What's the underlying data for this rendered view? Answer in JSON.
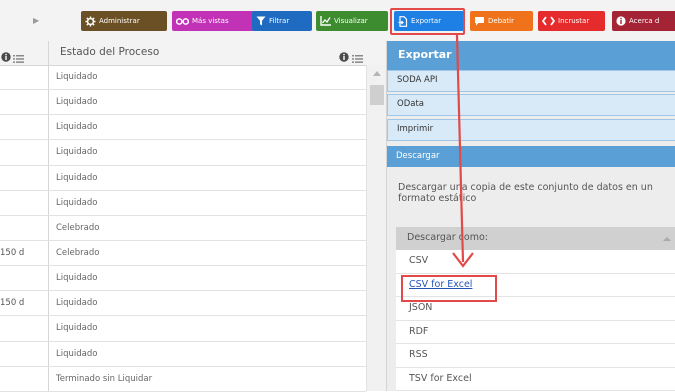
{
  "toolbar": {
    "buttons": [
      {
        "label": "Administrar",
        "icon": "gear-icon"
      },
      {
        "label": "Más vistas",
        "icon": "glasses-icon"
      },
      {
        "label": "Filtrar",
        "icon": "filter-icon"
      },
      {
        "label": "Visualizar",
        "icon": "chart-icon"
      },
      {
        "label": "Exportar",
        "icon": "export-icon"
      },
      {
        "label": "Debatir",
        "icon": "speech-bubble-icon"
      },
      {
        "label": "Incrustar",
        "icon": "code-brackets-icon"
      },
      {
        "label": "Acerca d",
        "icon": "info-icon"
      }
    ]
  },
  "grid": {
    "column_title": "Estado del Proceso",
    "rows": [
      {
        "left": "",
        "estado": "Liquidado"
      },
      {
        "left": "",
        "estado": "Liquidado"
      },
      {
        "left": "",
        "estado": "Liquidado"
      },
      {
        "left": "",
        "estado": "Liquidado"
      },
      {
        "left": "",
        "estado": "Liquidado"
      },
      {
        "left": "",
        "estado": "Liquidado"
      },
      {
        "left": "",
        "estado": "Celebrado"
      },
      {
        "left": "150 d",
        "estado": "Celebrado"
      },
      {
        "left": "",
        "estado": "Liquidado"
      },
      {
        "left": "150 d",
        "estado": "Liquidado"
      },
      {
        "left": "",
        "estado": "Liquidado"
      },
      {
        "left": "",
        "estado": "Liquidado"
      },
      {
        "left": "",
        "estado": "Terminado sin Liquidar"
      }
    ]
  },
  "panel": {
    "title": "Exportar",
    "options": [
      "SODA API",
      "OData",
      "Imprimir"
    ],
    "download_header": "Descargar",
    "download_desc": "Descargar una copia de este conjunto de datos en un formato estático",
    "format_header": "Descargar como:",
    "formats": [
      "CSV",
      "CSV for Excel",
      "JSON",
      "RDF",
      "RSS",
      "TSV for Excel"
    ]
  },
  "colors": {
    "highlight": "#e14a48",
    "panel_blue": "#5a9fd6",
    "link": "#2355b6"
  }
}
